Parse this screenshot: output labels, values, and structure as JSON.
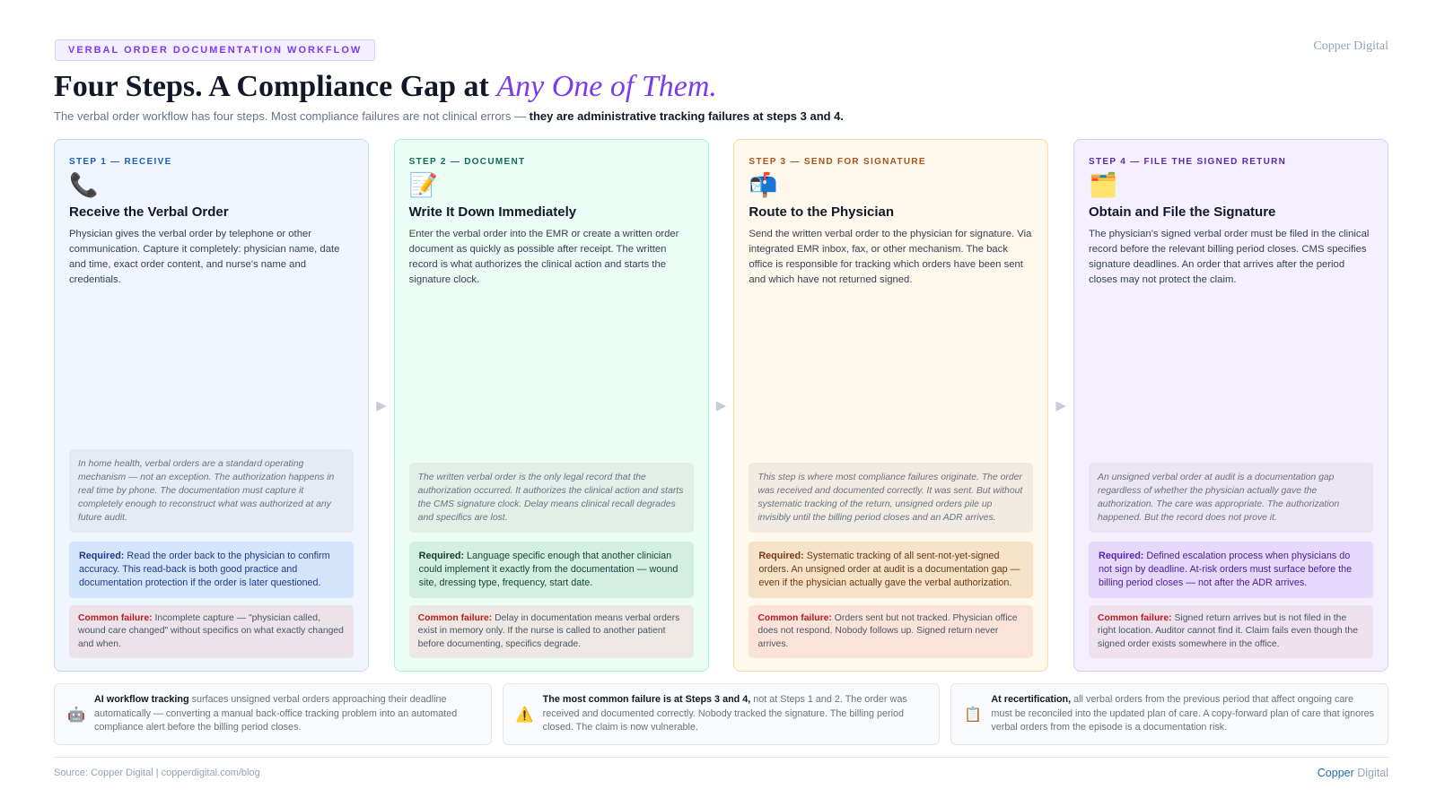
{
  "header": {
    "eyebrow": "VERBAL ORDER DOCUMENTATION WORKFLOW",
    "brand": "Copper Digital",
    "title_main": "Four Steps. A Compliance Gap at ",
    "title_accent": "Any One of Them.",
    "subtitle_plain": "The verbal order workflow has four steps. Most compliance failures are not clinical errors — ",
    "subtitle_bold": "they are administrative tracking failures at steps 3 and 4."
  },
  "steps": [
    {
      "label": "STEP 1 — RECEIVE",
      "icon": "📞",
      "icon_name": "telephone-icon",
      "title": "Receive the Verbal Order",
      "description": "Physician gives the verbal order by telephone or other communication. Capture it completely: physician name, date and time, exact order content, and nurse's name and credentials.",
      "note": "In home health, verbal orders are a standard operating mechanism — not an exception. The authorization happens in real time by phone. The documentation must capture it completely enough to reconstruct what was authorized at any future audit.",
      "required_label": "Required:",
      "required_text": " Read the order back to the physician to confirm accuracy. This read-back is both good practice and documentation protection if the order is later questioned.",
      "failure_label": "Common failure:",
      "failure_text": " Incomplete capture — \"physician called, wound care changed\" without specifics on what exactly changed and when."
    },
    {
      "label": "STEP 2 — DOCUMENT",
      "icon": "📝",
      "icon_name": "memo-icon",
      "title": "Write It Down Immediately",
      "description": "Enter the verbal order into the EMR or create a written order document as quickly as possible after receipt. The written record is what authorizes the clinical action and starts the signature clock.",
      "note": "The written verbal order is the only legal record that the authorization occurred. It authorizes the clinical action and starts the CMS signature clock. Delay means clinical recall degrades and specifics are lost.",
      "required_label": "Required:",
      "required_text": " Language specific enough that another clinician could implement it exactly from the documentation — wound site, dressing type, frequency, start date.",
      "failure_label": "Common failure:",
      "failure_text": " Delay in documentation means verbal orders exist in memory only. If the nurse is called to another patient before documenting, specifics degrade."
    },
    {
      "label": "STEP 3 — SEND FOR SIGNATURE",
      "icon": "📬",
      "icon_name": "mailbox-icon",
      "title": "Route to the Physician",
      "description": "Send the written verbal order to the physician for signature. Via integrated EMR inbox, fax, or other mechanism. The back office is responsible for tracking which orders have been sent and which have not returned signed.",
      "note": "This step is where most compliance failures originate. The order was received and documented correctly. It was sent. But without systematic tracking of the return, unsigned orders pile up invisibly until the billing period closes and an ADR arrives.",
      "required_label": "Required:",
      "required_text": " Systematic tracking of all sent-not-yet-signed orders. An unsigned order at audit is a documentation gap — even if the physician actually gave the verbal authorization.",
      "failure_label": "Common failure:",
      "failure_text": " Orders sent but not tracked. Physician office does not respond. Nobody follows up. Signed return never arrives."
    },
    {
      "label": "STEP 4 — FILE THE SIGNED RETURN",
      "icon": "🗂️",
      "icon_name": "card-index-dividers-icon",
      "title": "Obtain and File the Signature",
      "description": "The physician's signed verbal order must be filed in the clinical record before the relevant billing period closes. CMS specifies signature deadlines. An order that arrives after the period closes may not protect the claim.",
      "note": "An unsigned verbal order at audit is a documentation gap regardless of whether the physician actually gave the authorization. The care was appropriate. The authorization happened. But the record does not prove it.",
      "required_label": "Required:",
      "required_text": " Defined escalation process when physicians do not sign by deadline. At-risk orders must surface before the billing period closes — not after the ADR arrives.",
      "failure_label": "Common failure:",
      "failure_text": " Signed return arrives but is not filed in the right location. Auditor cannot find it. Claim fails even though the signed order exists somewhere in the office."
    }
  ],
  "arrow_glyph": "▶",
  "callouts": [
    {
      "icon": "🤖",
      "icon_name": "robot-icon",
      "bold": "AI workflow tracking",
      "text": " surfaces unsigned verbal orders approaching their deadline automatically — converting a manual back-office tracking problem into an automated compliance alert before the billing period closes."
    },
    {
      "icon": "⚠️",
      "icon_name": "warning-icon",
      "bold": "The most common failure is at Steps 3 and 4,",
      "text": " not at Steps 1 and 2. The order was received and documented correctly. Nobody tracked the signature. The billing period closed. The claim is now vulnerable."
    },
    {
      "icon": "📋",
      "icon_name": "clipboard-icon",
      "bold": "At recertification,",
      "text": " all verbal orders from the previous period that affect ongoing care must be reconciled into the updated plan of care. A copy-forward plan of care that ignores verbal orders from the episode is a documentation risk."
    }
  ],
  "footer": {
    "source": "Source: Copper Digital | copperdigital.com/blog",
    "brand_first": "Copper",
    "brand_second": " Digital"
  }
}
